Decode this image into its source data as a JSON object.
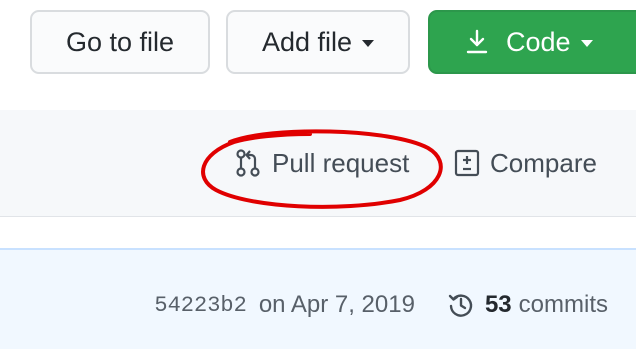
{
  "toolbar": {
    "go_to_file_label": "Go to file",
    "add_file_label": "Add file",
    "code_label": "Code"
  },
  "repo_actions": {
    "pull_request_label": "Pull request",
    "compare_label": "Compare"
  },
  "commit_info": {
    "sha": "54223b2",
    "date_text": "on Apr 7, 2019",
    "commit_count": "53",
    "commits_label": "commits"
  },
  "colors": {
    "primary_green": "#2ea44f",
    "annotation_red": "#e00000",
    "commit_bar_bg": "#f1f8ff",
    "mid_bar_bg": "#f6f8fa"
  },
  "icons": {
    "code_button": "download-icon",
    "pull_request": "git-pull-request-icon",
    "compare": "diff-icon",
    "history": "history-icon"
  }
}
